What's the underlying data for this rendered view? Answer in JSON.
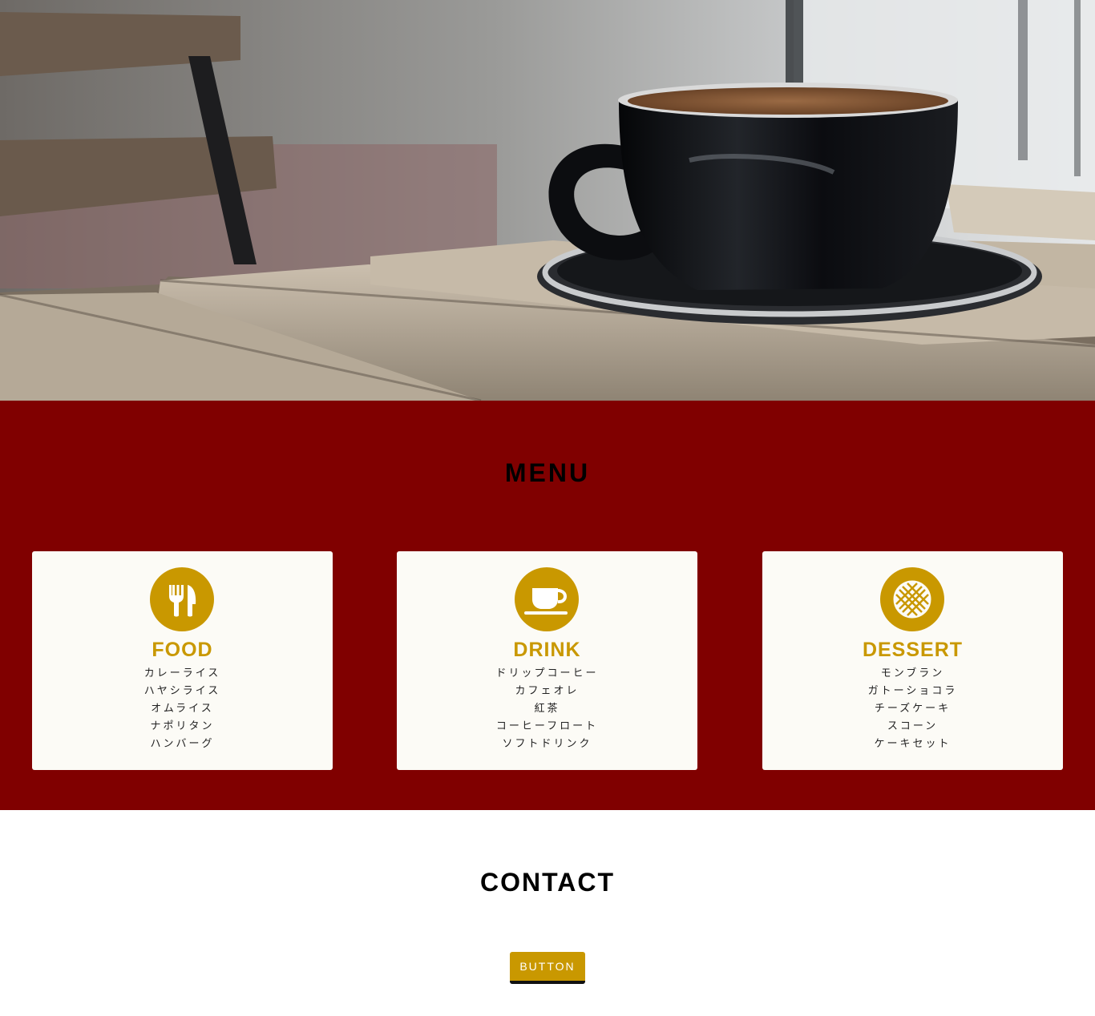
{
  "hero": {
    "image_alt": "coffee-cup-on-wooden-table-photo"
  },
  "menu": {
    "title": "MENU",
    "background_color": "#800000",
    "accent_color": "#c99800",
    "cards": [
      {
        "icon": "fork-knife-icon",
        "title": "FOOD",
        "items": [
          "カレーライス",
          "ハヤシライス",
          "オムライス",
          "ナポリタン",
          "ハンバーグ"
        ]
      },
      {
        "icon": "coffee-cup-icon",
        "title": "DRINK",
        "items": [
          "ドリップコーヒー",
          "カフェオレ",
          "紅茶",
          "コーヒーフロート",
          "ソフトドリンク"
        ]
      },
      {
        "icon": "waffle-icon",
        "title": "DESSERT",
        "items": [
          "モンブラン",
          "ガトーショコラ",
          "チーズケーキ",
          "スコーン",
          "ケーキセット"
        ]
      }
    ]
  },
  "contact": {
    "title": "CONTACT",
    "button_label": "BUTTON"
  }
}
